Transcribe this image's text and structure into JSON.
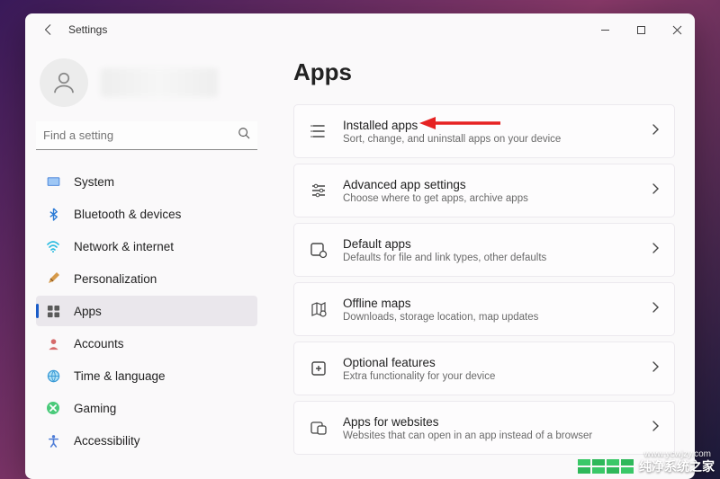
{
  "window": {
    "title": "Settings"
  },
  "search": {
    "placeholder": "Find a setting"
  },
  "nav": {
    "items": [
      {
        "label": "System"
      },
      {
        "label": "Bluetooth & devices"
      },
      {
        "label": "Network & internet"
      },
      {
        "label": "Personalization"
      },
      {
        "label": "Apps"
      },
      {
        "label": "Accounts"
      },
      {
        "label": "Time & language"
      },
      {
        "label": "Gaming"
      },
      {
        "label": "Accessibility"
      }
    ],
    "selected_index": 4
  },
  "page": {
    "title": "Apps"
  },
  "cards": [
    {
      "title": "Installed apps",
      "subtitle": "Sort, change, and uninstall apps on your device"
    },
    {
      "title": "Advanced app settings",
      "subtitle": "Choose where to get apps, archive apps"
    },
    {
      "title": "Default apps",
      "subtitle": "Defaults for file and link types, other defaults"
    },
    {
      "title": "Offline maps",
      "subtitle": "Downloads, storage location, map updates"
    },
    {
      "title": "Optional features",
      "subtitle": "Extra functionality for your device"
    },
    {
      "title": "Apps for websites",
      "subtitle": "Websites that can open in an app instead of a browser"
    }
  ],
  "watermark": {
    "text": "纯净系统之家",
    "url": "www.ycwjzy.com"
  }
}
